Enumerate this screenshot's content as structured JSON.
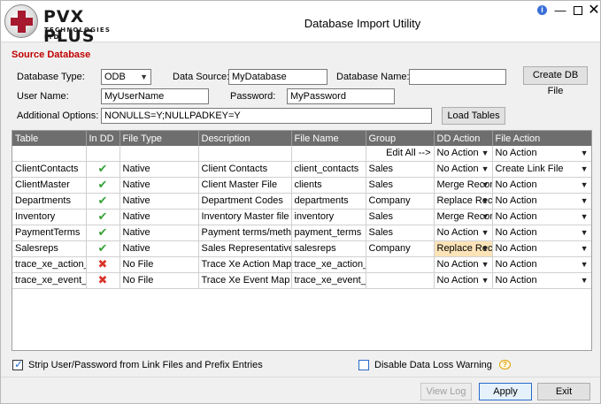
{
  "window": {
    "title": "Database Import Utility",
    "logo_main": "PVX PLUS",
    "logo_sub": "TECHNOLOGIES LTD.",
    "info_icon": "i",
    "min_icon": "—",
    "close_icon": "✕"
  },
  "source": {
    "section_title": "Source Database",
    "db_type_label": "Database Type:",
    "db_type_value": "ODB",
    "data_source_label": "Data Source:",
    "data_source_value": "MyDatabase",
    "db_name_label": "Database Name:",
    "db_name_value": "",
    "create_db_file_label": "Create DB File",
    "user_name_label": "User Name:",
    "user_name_value": "MyUserName",
    "password_label": "Password:",
    "password_value": "MyPassword",
    "options_label": "Additional Options:",
    "options_value": "NONULLS=Y;NULLPADKEY=Y",
    "load_tables_label": "Load Tables"
  },
  "grid": {
    "columns": [
      "Table",
      "In DD",
      "File Type",
      "Description",
      "File Name",
      "Group",
      "DD Action",
      "File Action"
    ],
    "edit_all_label": "Edit All -->",
    "edit_all_dd_action": "No Action",
    "edit_all_file_action": "No Action",
    "rows": [
      {
        "table": "ClientContacts",
        "in_dd": "check",
        "file_type": "Native",
        "description": "Client Contacts",
        "file_name": "client_contacts",
        "group": "Sales",
        "dd_action": "No Action",
        "file_action": "Create Link File"
      },
      {
        "table": "ClientMaster",
        "in_dd": "check",
        "file_type": "Native",
        "description": "Client Master File",
        "file_name": "clients",
        "group": "Sales",
        "dd_action": "Merge Records",
        "file_action": "No Action"
      },
      {
        "table": "Departments",
        "in_dd": "check",
        "file_type": "Native",
        "description": "Department Codes",
        "file_name": "departments",
        "group": "Company",
        "dd_action": "Replace Record",
        "file_action": "No Action"
      },
      {
        "table": "Inventory",
        "in_dd": "check",
        "file_type": "Native",
        "description": "Inventory Master file",
        "file_name": "inventory",
        "group": "Sales",
        "dd_action": "Merge Records",
        "file_action": "No Action"
      },
      {
        "table": "PaymentTerms",
        "in_dd": "check",
        "file_type": "Native",
        "description": "Payment terms/methods",
        "file_name": "payment_terms",
        "group": "Sales",
        "dd_action": "No Action",
        "file_action": "No Action"
      },
      {
        "table": "Salesreps",
        "in_dd": "check",
        "file_type": "Native",
        "description": "Sales Representatives",
        "file_name": "salesreps",
        "group": "Company",
        "dd_action": "Replace Record",
        "file_action": "No Action",
        "highlight_dd": true
      },
      {
        "table": "trace_xe_action_map",
        "in_dd": "cross",
        "file_type": "No File",
        "description": "Trace Xe Action Map",
        "file_name": "trace_xe_action_map",
        "group": "",
        "dd_action": "No Action",
        "file_action": "No Action"
      },
      {
        "table": "trace_xe_event_map",
        "in_dd": "cross",
        "file_type": "No File",
        "description": "Trace Xe Event Map",
        "file_name": "trace_xe_event_map",
        "group": "",
        "dd_action": "No Action",
        "file_action": "No Action"
      }
    ]
  },
  "footer": {
    "strip_label": "Strip User/Password from Link Files and Prefix Entries",
    "strip_checked": true,
    "disable_label": "Disable Data Loss Warning",
    "disable_checked": false,
    "view_log_label": "View Log",
    "apply_label": "Apply",
    "exit_label": "Exit"
  },
  "colors": {
    "section_title": "#c00000",
    "header_bg": "#6e6e6e",
    "highlight": "#fde4b8",
    "check": "#3aa33a",
    "cross": "#d9352a"
  },
  "icons": {
    "dropdown": "▼",
    "check": "✔",
    "cross": "✖"
  }
}
